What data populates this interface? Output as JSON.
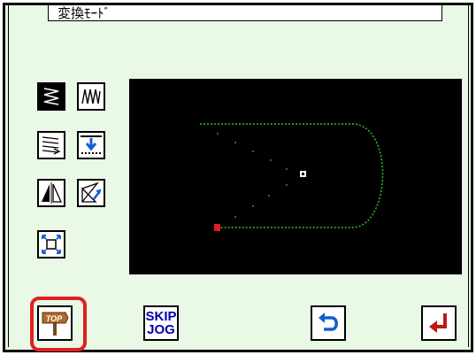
{
  "title": "変換ﾓｰﾄﾞ",
  "tools": {
    "zigzag": "zigzag-icon",
    "wave": "wave-icon",
    "multi_line": "multi-line-icon",
    "insert": "insert-icon",
    "mirror": "mirror-icon",
    "rotate": "rotate-icon",
    "scale": "scale-icon"
  },
  "bottom": {
    "top_label": "TOP",
    "skip_label": "SKIP",
    "jog_label": "JOG"
  },
  "colors": {
    "background": "#e9f9e6",
    "stitch": "#22cc22",
    "accent_red": "#e02020",
    "icon_blue": "#1060d0"
  }
}
